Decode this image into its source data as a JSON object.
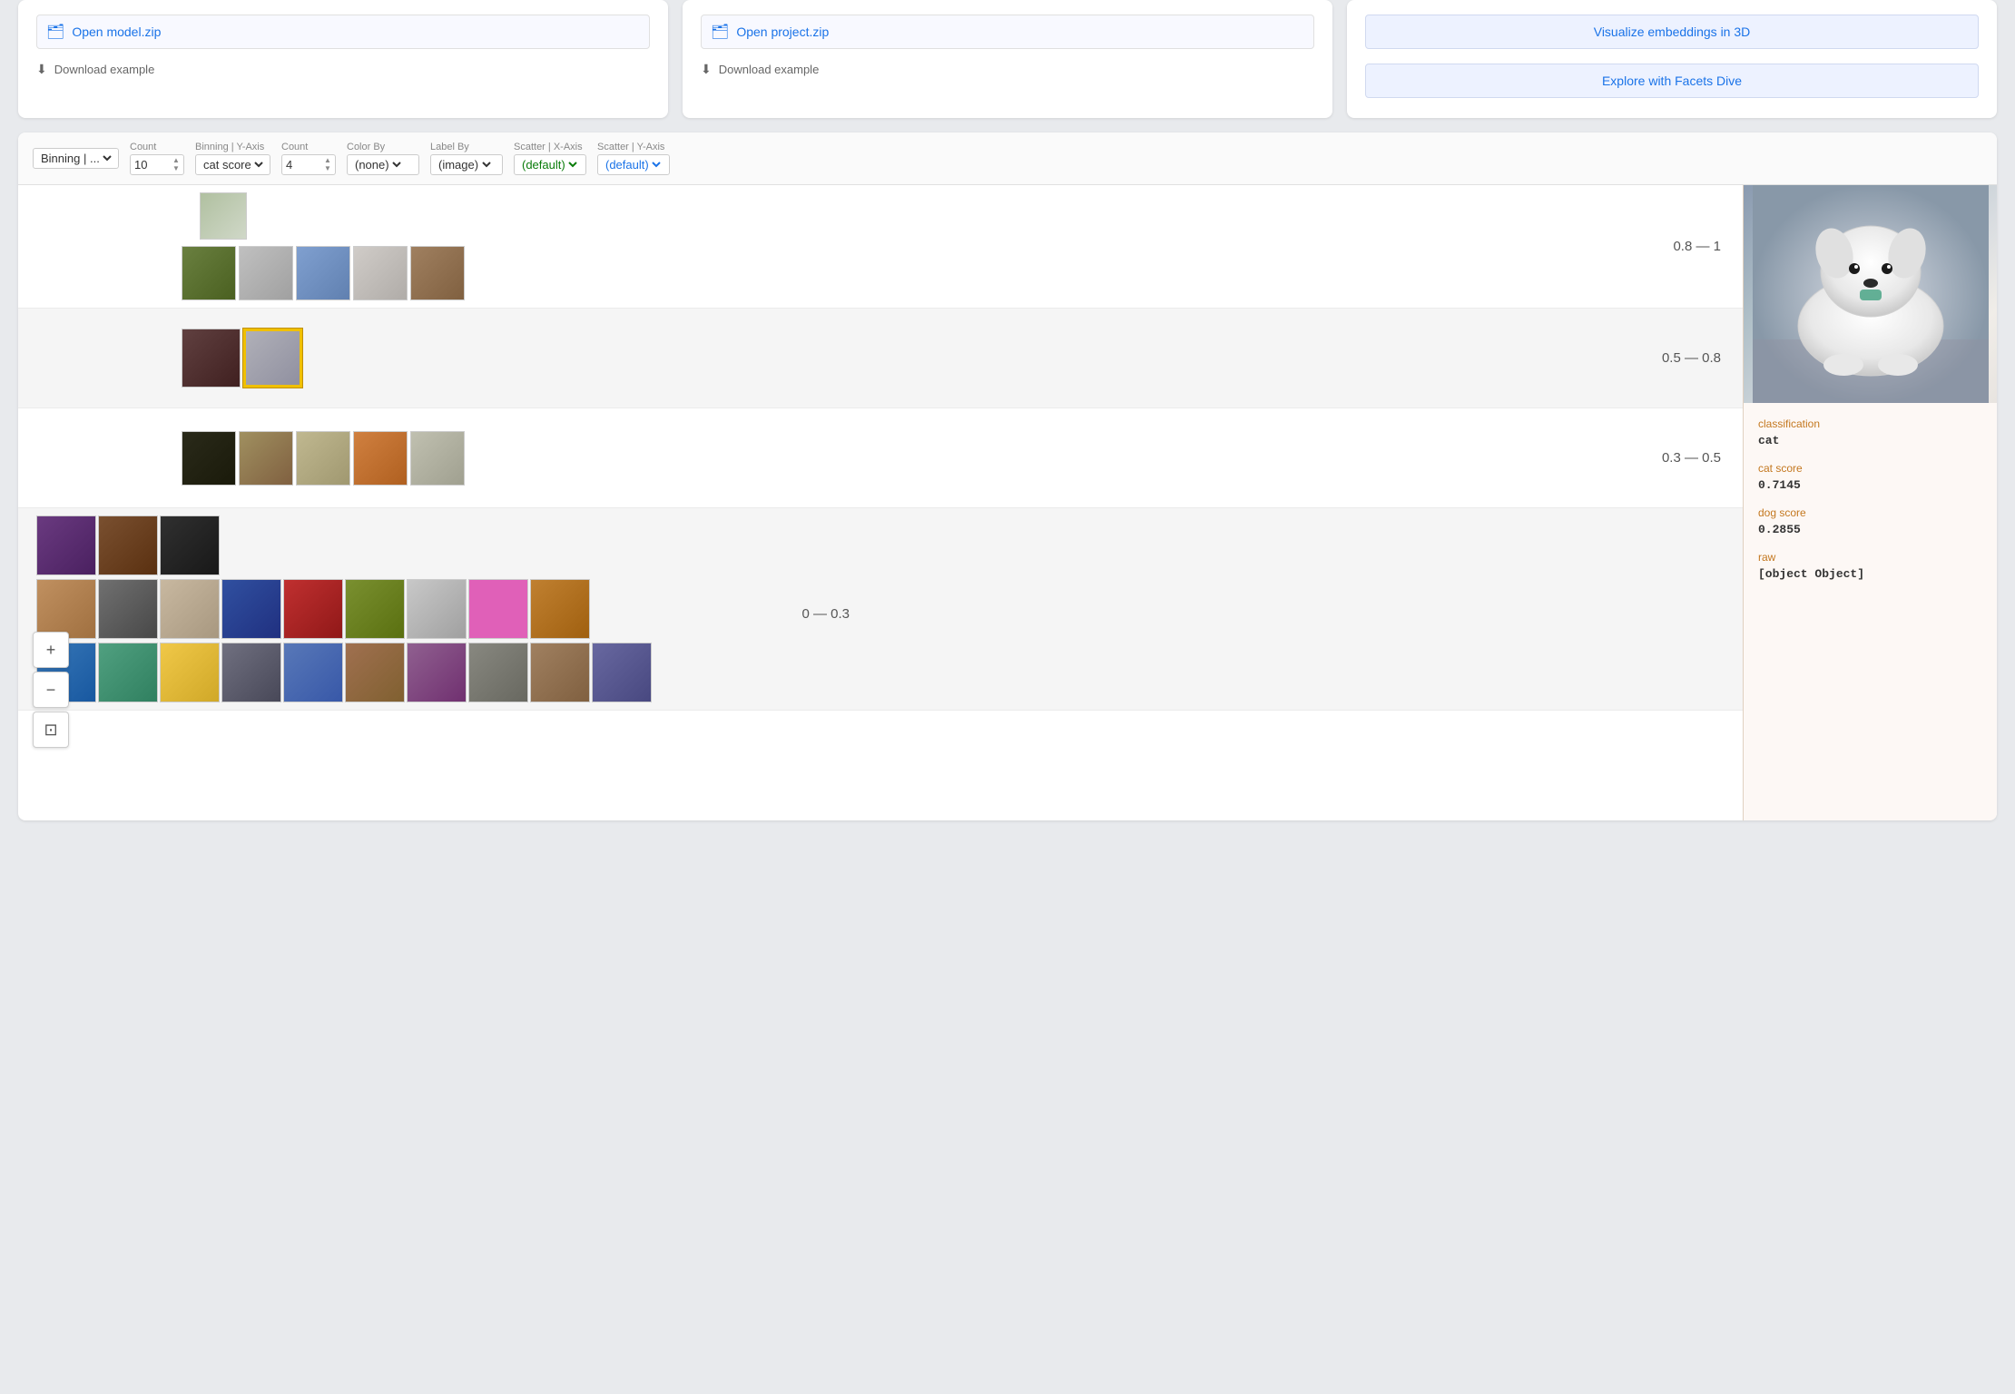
{
  "topCards": [
    {
      "id": "model",
      "button": "Open model.zip",
      "link": "Download example"
    },
    {
      "id": "project",
      "button": "Open project.zip",
      "link": "Download example"
    },
    {
      "id": "explore",
      "buttons": [
        "Visualize embeddings in 3D",
        "Explore with Facets Dive"
      ]
    }
  ],
  "toolbar": {
    "binning_x_label": "Binning | ...",
    "count_x_label": "Count",
    "count_x_value": "10",
    "binning_y_label": "Binning | Y-Axis",
    "binning_y_value": "cat score",
    "count_y_label": "Count",
    "count_y_value": "4",
    "color_by_label": "Color By",
    "color_by_value": "(none)",
    "label_by_label": "Label By",
    "label_by_value": "(image)",
    "scatter_x_label": "Scatter | X-Axis",
    "scatter_x_value": "(default)",
    "scatter_y_label": "Scatter | Y-Axis",
    "scatter_y_value": "(default)"
  },
  "rows": [
    {
      "id": "row1",
      "label": "0.8 — 1",
      "bg": "white"
    },
    {
      "id": "row2",
      "label": "0.5 — 0.8",
      "bg": "light"
    },
    {
      "id": "row3",
      "label": "0.3 — 0.5",
      "bg": "white"
    },
    {
      "id": "row4",
      "label": "0 — 0.3",
      "bg": "light"
    }
  ],
  "sidePanel": {
    "fields": [
      {
        "label": "classification",
        "value": "cat"
      },
      {
        "label": "cat score",
        "value": "0.7145"
      },
      {
        "label": "dog score",
        "value": "0.2855"
      },
      {
        "label": "raw",
        "value": "[object Object]"
      }
    ]
  },
  "zoomControls": {
    "plus": "+",
    "minus": "−",
    "fit": "⊡"
  }
}
